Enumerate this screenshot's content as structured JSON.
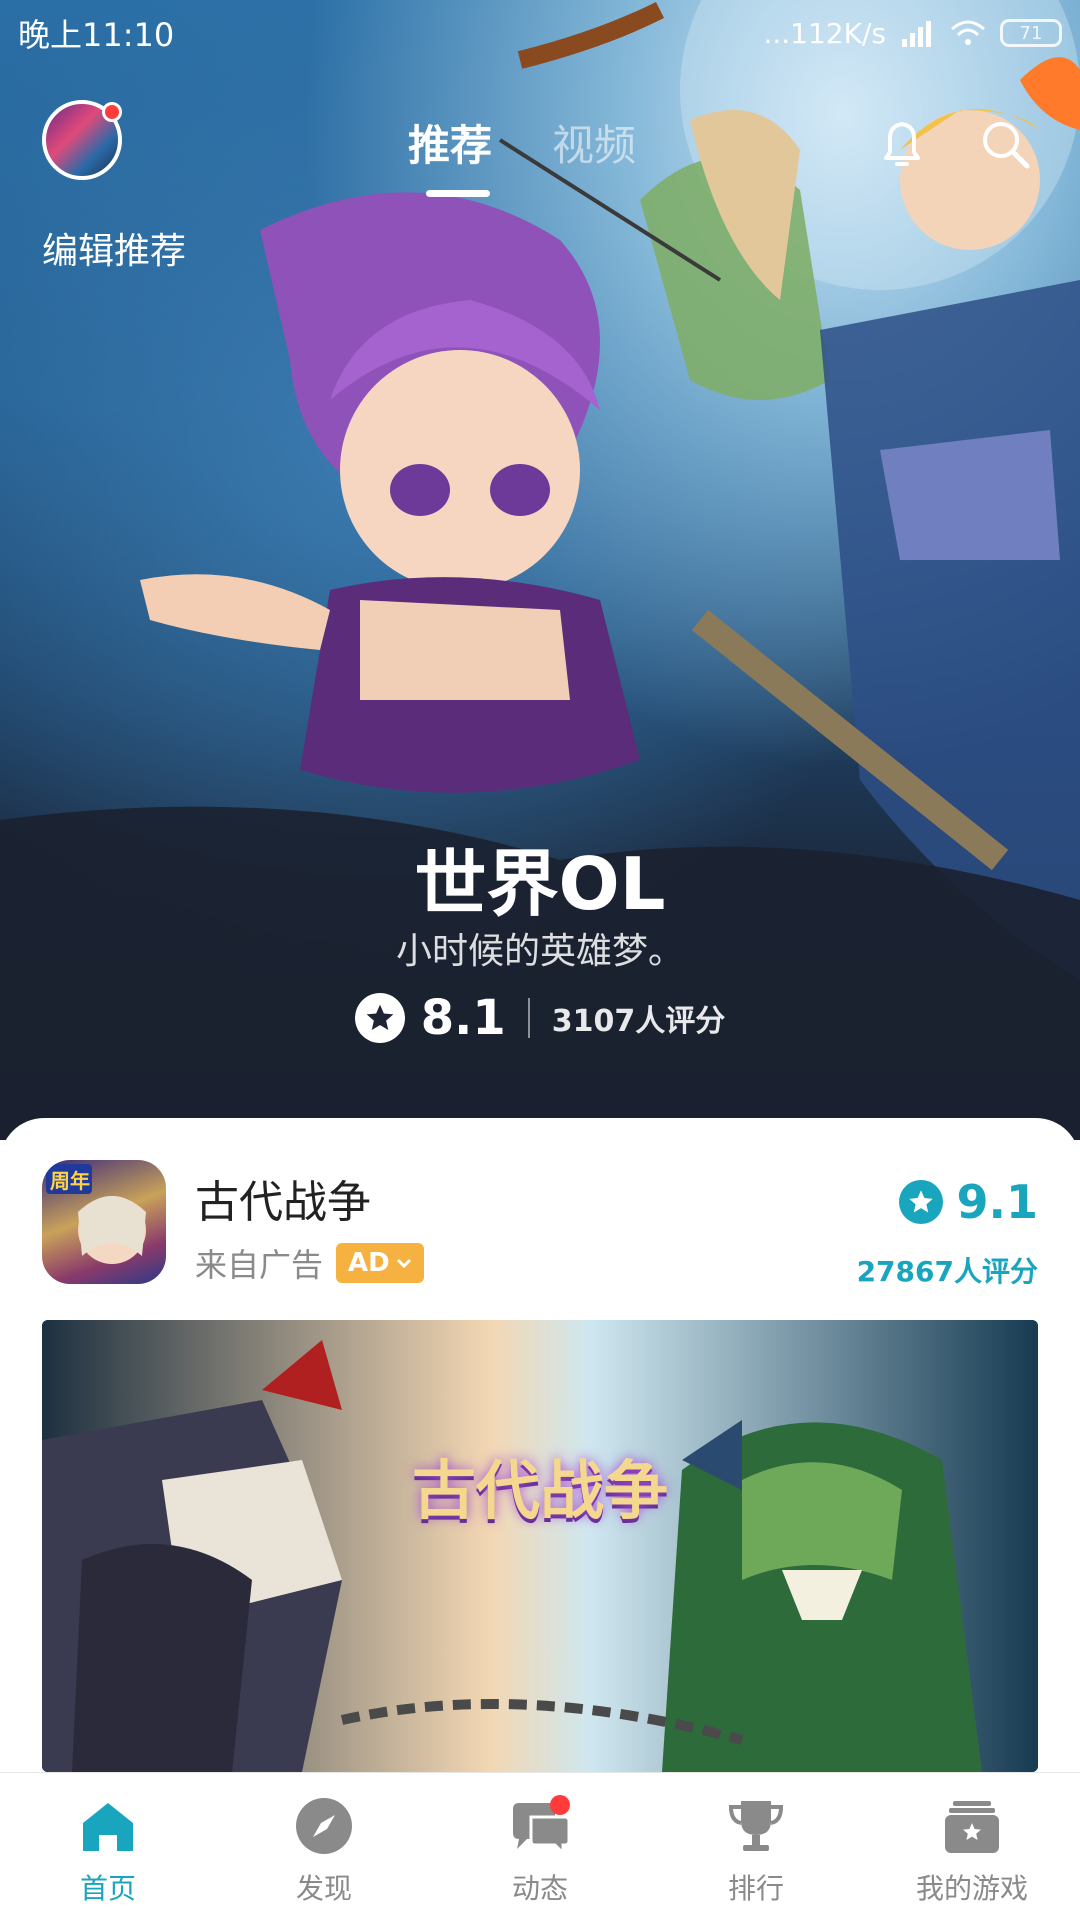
{
  "status_bar": {
    "time": "晚上11:10",
    "network_speed": "...112K/s",
    "battery": "71"
  },
  "header": {
    "edit_label": "编辑推荐",
    "tabs": [
      {
        "label": "推荐",
        "active": true
      },
      {
        "label": "视频",
        "active": false
      }
    ],
    "icons": [
      "bell-icon",
      "search-icon"
    ]
  },
  "hero": {
    "title": "世界OL",
    "subtitle": "小时候的英雄梦。",
    "score": "8.1",
    "rating_count": "3107人评分"
  },
  "featured_app": {
    "name": "古代战争",
    "source": "来自广告",
    "ad_badge": "AD",
    "score": "9.1",
    "rating_count": "27867人评分",
    "banner_title": "古代战争",
    "icon_badge": "周年"
  },
  "bottom_nav": [
    {
      "label": "首页",
      "icon": "home-icon",
      "active": true
    },
    {
      "label": "发现",
      "icon": "compass-icon",
      "active": false
    },
    {
      "label": "动态",
      "icon": "messages-icon",
      "active": false,
      "badge": true
    },
    {
      "label": "排行",
      "icon": "trophy-icon",
      "active": false
    },
    {
      "label": "我的游戏",
      "icon": "my-games-icon",
      "active": false
    }
  ],
  "colors": {
    "accent": "#1aa5bf",
    "ad_badge": "#f6b240",
    "notification": "#ff3b3b"
  }
}
